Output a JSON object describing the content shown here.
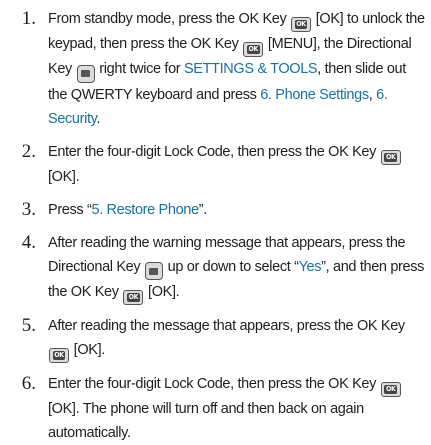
{
  "steps": [
    {
      "number": "1.",
      "parts": [
        {
          "t": "From standby mode, press the OK Key "
        },
        {
          "icon": "ok"
        },
        {
          "t": " [OK] to unlock the keypad, then press the OK Key "
        },
        {
          "icon": "ok"
        },
        {
          "t": " [MENU], the Directional Key "
        },
        {
          "icon": "dir"
        },
        {
          "t": " right twice for "
        },
        {
          "t": "SETTINGS & TOOLS",
          "hl": true
        },
        {
          "t": ", then slide out the QWERTY keyboard and press "
        },
        {
          "t": "6. Phone Settings",
          "hl": true
        },
        {
          "t": ", "
        },
        {
          "t": "6. Security",
          "hl": true
        },
        {
          "t": "."
        }
      ]
    },
    {
      "number": "2.",
      "parts": [
        {
          "t": "Enter the four-digit Lock Code, then press the OK Key "
        },
        {
          "icon": "ok"
        },
        {
          "t": " [OK]."
        }
      ]
    },
    {
      "number": "3.",
      "parts": [
        {
          "t": "Press “"
        },
        {
          "t": "5. Restore Phone",
          "hl": true
        },
        {
          "t": "”."
        }
      ]
    },
    {
      "number": "4.",
      "parts": [
        {
          "t": "After reading the warning message that appears, press the Directional Key "
        },
        {
          "icon": "dir"
        },
        {
          "t": " up or down to select “"
        },
        {
          "t": "Yes",
          "hl": true
        },
        {
          "t": "”, and then press the OK Key "
        },
        {
          "icon": "ok"
        },
        {
          "t": " [OK]."
        }
      ]
    },
    {
      "number": "5.",
      "parts": [
        {
          "t": "After reading the message that appears, press the OK Key "
        },
        {
          "icon": "ok"
        },
        {
          "t": " [OK]."
        }
      ]
    },
    {
      "number": "6.",
      "parts": [
        {
          "t": "Enter the four-digit Lock Code, then press the OK Key "
        },
        {
          "icon": "ok"
        },
        {
          "t": " [OK]. The phone will turn off and then back on again automatically."
        }
      ]
    }
  ],
  "icons": {
    "ok": {
      "name": "ok-key-icon",
      "glyph": "OK"
    },
    "dir": {
      "name": "directional-key-icon",
      "glyph": ""
    }
  },
  "colors": {
    "highlight": "#1a6fa3",
    "text": "#1e1e1e"
  }
}
